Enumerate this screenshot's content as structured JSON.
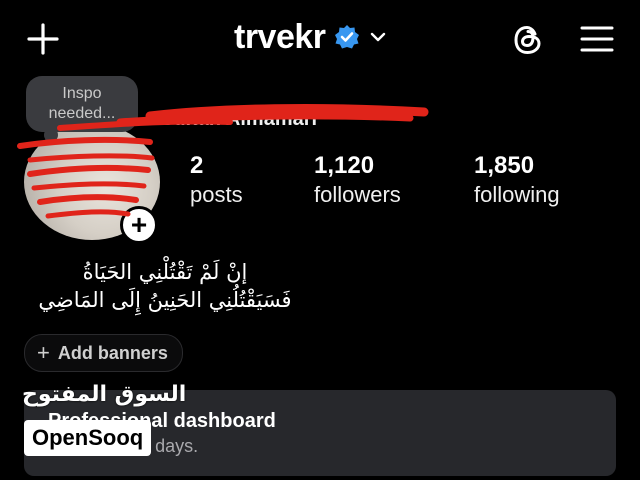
{
  "header": {
    "username": "trvekr",
    "icons": {
      "create": "plus-icon",
      "verified": "verified-badge-icon",
      "account_switch": "chevron-down-icon",
      "threads": "threads-icon",
      "menu": "hamburger-menu-icon"
    },
    "verified_color": "#3897f0"
  },
  "profile": {
    "note_text_line1": "Inspo",
    "note_text_line2": "needed...",
    "full_name": "Sultan Almamari",
    "add_story_symbol": "+",
    "stats": [
      {
        "value": "2",
        "label": "posts"
      },
      {
        "value": "1,120",
        "label": "followers"
      },
      {
        "value": "1,850",
        "label": "following"
      }
    ],
    "bio_line1": "إنْ لَمْ تَقْتُلْنِي الحَيَاةُ",
    "bio_line2": "فَسَيَقْتُلُنِي الحَنِينُ إِلَى المَاضِي",
    "redaction_color": "#e0241a"
  },
  "actions": {
    "add_banners_symbol": "+",
    "add_banners_label": "Add banners"
  },
  "dashboard": {
    "title": "Professional dashboard",
    "subtitle": "in the last 30 days."
  },
  "watermark": {
    "arabic": "السوق المفتوح",
    "brand": "OpenSooq"
  }
}
